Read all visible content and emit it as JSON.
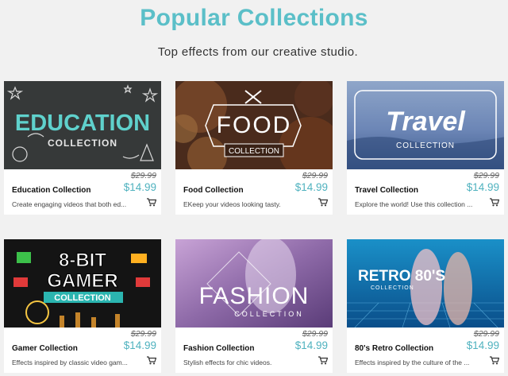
{
  "header": {
    "title": "Popular Collections",
    "subtitle": "Top effects from our creative studio."
  },
  "cards": [
    {
      "thumb_text": [
        "EDUCATION",
        "COLLECTION"
      ],
      "name": "Education Collection",
      "old_price": "$29.99",
      "price": "$14.99",
      "description": "Create engaging videos that both ed..."
    },
    {
      "thumb_text": [
        "FOOD",
        "COLLECTION"
      ],
      "name": "Food Collection",
      "old_price": "$29.99",
      "price": "$14.99",
      "description": "EKeep your videos looking tasty."
    },
    {
      "thumb_text": [
        "Travel",
        "COLLECTION"
      ],
      "name": "Travel Collection",
      "old_price": "$29.99",
      "price": "$14.99",
      "description": "Explore the world! Use this collection ..."
    },
    {
      "thumb_text": [
        "8-BIT",
        "GAMER",
        "COLLECTION"
      ],
      "name": "Gamer Collection",
      "old_price": "$29.99",
      "price": "$14.99",
      "description": "Effects inspired by classic video gam..."
    },
    {
      "thumb_text": [
        "FASHION",
        "COLLECTION"
      ],
      "name": "Fashion Collection",
      "old_price": "$29.99",
      "price": "$14.99",
      "description": "Stylish effects for chic videos."
    },
    {
      "thumb_text": [
        "RETRO 80'S",
        "COLLECTION"
      ],
      "name": "80's Retro Collection",
      "old_price": "$29.99",
      "price": "$14.99",
      "description": "Effects inspired by the culture of the ..."
    }
  ],
  "icons": {
    "cart": "shopping-cart-icon"
  },
  "colors": {
    "accent": "#5bbfc8",
    "price": "#4fb2bf"
  }
}
